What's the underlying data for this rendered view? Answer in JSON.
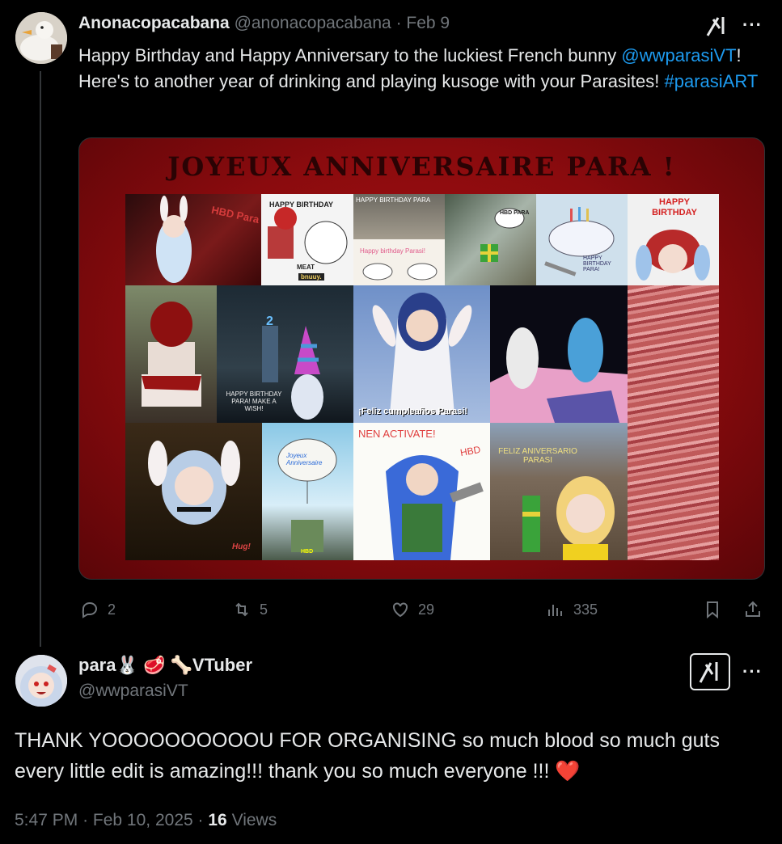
{
  "tweet1": {
    "display_name": "Anonacopacabana",
    "handle": "@anonacopacabana",
    "separator": "·",
    "date": "Feb 9",
    "text_part1": "Happy Birthday and Happy Anniversary to the luckiest French bunny ",
    "mention": "@wwparasiVT",
    "text_part2": "! Here's to another year of drinking and playing kusoge with your Parasites! ",
    "hashtag": "#parasiART",
    "more_icon": "more-dots-icon",
    "grok_icon": "grok-icon",
    "media": {
      "title": "JOYEUX ANNIVERSAIRE PARA !",
      "captions": {
        "hbd_para": "HBD Para",
        "happy_birthday_1": "HAPPY BIRTHDAY",
        "meat": "MEAT",
        "bnuuy": "bnuuy.",
        "happy_birthday_para": "HAPPY BIRTHDAY PARA",
        "happy_birthday_parasi": "Happy birthday Parasi!",
        "hbd_para_2": "HBD PARA",
        "happy_birthday_paraa": "HAPPY BIRTHDAY PARA!",
        "happy_birthday_red": "HAPPY BIRTHDAY",
        "happy_birthday_para_make_wish": "HAPPY BIRTHDAY PARA! MAKE A WISH!",
        "number_two": "2",
        "feliz_cumpleanos": "¡Feliz cumpleaños Parasi!",
        "joyeux_anniversaire": "Joyeux Anniversaire",
        "nen_activate": "NEN ACTIVATE!",
        "hbd": "HBD",
        "feliz_aniversario": "FELIZ ANIVERSARIO PARASI",
        "hbd_cake": "HBD",
        "hug": "Hug!"
      }
    },
    "actions": {
      "replies": "2",
      "reposts": "5",
      "likes": "29",
      "views": "335"
    }
  },
  "tweet2": {
    "display_name": "para🐰 🥩 🦴VTuber",
    "handle": "@wwparasiVT",
    "text": "THANK YOOOOOOOOOOU FOR ORGANISING so much blood so much guts every little edit is amazing!!! thank you so much everyone !!! ❤️",
    "time": "5:47 PM",
    "separator": "·",
    "date": "Feb 10, 2025",
    "separator2": "·",
    "views_count": "16",
    "views_label": "Views"
  },
  "colors": {
    "background": "#000000",
    "text": "#e7e9ea",
    "muted": "#71767b",
    "link": "#1d9bf0",
    "heart": "#f91880"
  }
}
